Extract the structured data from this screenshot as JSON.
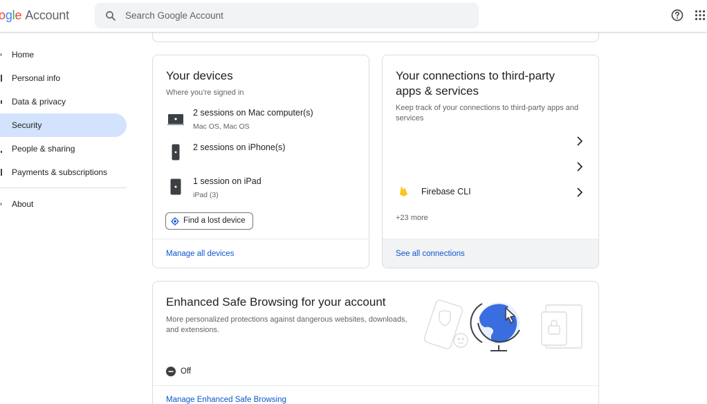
{
  "header": {
    "logo_partial": "ogle",
    "logo_word": "Account",
    "search_placeholder": "Search Google Account"
  },
  "sidebar": {
    "items": [
      {
        "label": "Home"
      },
      {
        "label": "Personal info"
      },
      {
        "label": "Data & privacy"
      },
      {
        "label": "Security",
        "active": true
      },
      {
        "label": "People & sharing"
      },
      {
        "label": "Payments & subscriptions"
      },
      {
        "label": "About"
      }
    ]
  },
  "devices_card": {
    "title": "Your devices",
    "subtitle": "Where you’re signed in",
    "devices": [
      {
        "title": "2 sessions on Mac computer(s)",
        "detail": "Mac OS, Mac OS",
        "icon": "laptop-icon"
      },
      {
        "title": "2 sessions on iPhone(s)",
        "detail": "",
        "icon": "phone-icon"
      },
      {
        "title": "1 session on iPad",
        "detail": "iPad (3)",
        "icon": "tablet-icon"
      }
    ],
    "find_button": "Find a lost device",
    "footer_link": "Manage all devices"
  },
  "connections_card": {
    "title_line1": "Your connections to third-party",
    "title_line2": "apps & services",
    "description_line1": "Keep track of your connections to third-party apps and",
    "description_line2": "services",
    "items": [
      {
        "name": "",
        "icon": ""
      },
      {
        "name": "",
        "icon": ""
      },
      {
        "name": "Firebase CLI",
        "icon": "firebase-icon"
      }
    ],
    "more": "+23 more",
    "footer_link": "See all connections"
  },
  "safe_browsing_card": {
    "title": "Enhanced Safe Browsing for your account",
    "description_line1": "More personalized protections against dangerous websites, downloads,",
    "description_line2": "and extensions.",
    "status": "Off",
    "footer_link": "Manage Enhanced Safe Browsing"
  },
  "colors": {
    "accent": "#0b57d0",
    "active_nav": "#d3e3fd",
    "border": "#dadce0",
    "firebase": "#ffca28"
  }
}
